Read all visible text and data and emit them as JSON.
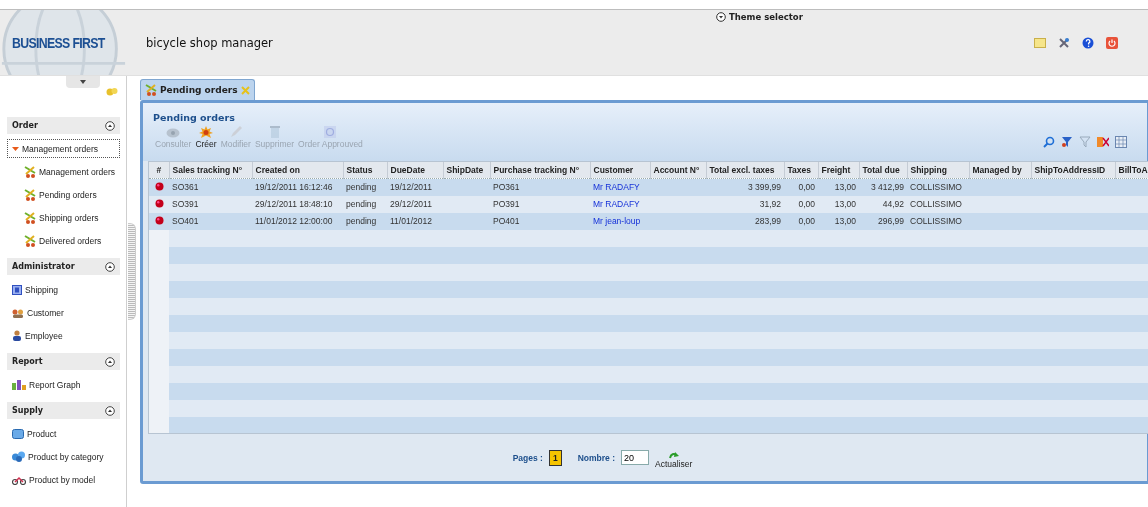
{
  "header": {
    "logo": "BUSINESS FIRST",
    "app_title": "bicycle shop manager",
    "theme_selector": "Theme selector"
  },
  "sidebar": {
    "groups": [
      {
        "title": "Order",
        "expanded": true,
        "items": [
          {
            "label": "Management orders",
            "kind": "folder",
            "expanded": true,
            "selected": true,
            "children": [
              {
                "label": "Management orders",
                "kind": "orders",
                "selected": false
              },
              {
                "label": "Pending orders",
                "kind": "orders",
                "selected": false
              },
              {
                "label": "Shipping orders",
                "kind": "orders",
                "selected": false
              },
              {
                "label": "Delivered orders",
                "kind": "orders",
                "selected": false
              }
            ]
          }
        ]
      },
      {
        "title": "Administrator",
        "expanded": true,
        "items": [
          {
            "label": "Shipping",
            "kind": "shipping",
            "selected": false
          },
          {
            "label": "Customer",
            "kind": "customer",
            "selected": false
          },
          {
            "label": "Employee",
            "kind": "employee",
            "selected": false
          }
        ]
      },
      {
        "title": "Report",
        "expanded": true,
        "items": [
          {
            "label": "Report Graph",
            "kind": "report",
            "selected": false
          }
        ]
      },
      {
        "title": "Supply",
        "expanded": true,
        "items": [
          {
            "label": "Product",
            "kind": "product",
            "selected": false
          },
          {
            "label": "Product by category",
            "kind": "category",
            "selected": false
          },
          {
            "label": "Product by model",
            "kind": "bike",
            "selected": false
          }
        ]
      }
    ]
  },
  "tabs": [
    {
      "label": "Pending orders",
      "selected": true
    }
  ],
  "panel": {
    "title": "Pending orders",
    "toolbar": [
      {
        "label": "Consulter",
        "kind": "view",
        "disabled": true
      },
      {
        "label": "Créer",
        "kind": "create",
        "disabled": false
      },
      {
        "label": "Modifier",
        "kind": "edit",
        "disabled": true
      },
      {
        "label": "Supprimer",
        "kind": "delete",
        "disabled": true
      },
      {
        "label": "Order Approuved",
        "kind": "approve",
        "disabled": true
      }
    ],
    "table": {
      "columns": [
        {
          "label": "#",
          "kind": "status"
        },
        {
          "label": "Sales tracking N°",
          "kind": "text"
        },
        {
          "label": "Created on",
          "kind": "text"
        },
        {
          "label": "Status",
          "kind": "text"
        },
        {
          "label": "DueDate",
          "kind": "text"
        },
        {
          "label": "ShipDate",
          "kind": "text"
        },
        {
          "label": "Purchase tracking N°",
          "kind": "text"
        },
        {
          "label": "Customer",
          "kind": "link"
        },
        {
          "label": "Account N°",
          "kind": "text"
        },
        {
          "label": "Total excl. taxes",
          "kind": "number"
        },
        {
          "label": "Taxes",
          "kind": "number"
        },
        {
          "label": "Freight",
          "kind": "number"
        },
        {
          "label": "Total due",
          "kind": "number"
        },
        {
          "label": "Shipping",
          "kind": "text"
        },
        {
          "label": "Managed by",
          "kind": "text"
        },
        {
          "label": "ShipToAddressID",
          "kind": "text"
        },
        {
          "label": "BillToA",
          "kind": "text"
        }
      ],
      "rows": [
        {
          "selected": false,
          "cells": [
            "",
            "SO361",
            "19/12/2011 16:12:46",
            "pending",
            "19/12/2011",
            "",
            "PO361",
            "Mr RADAFY",
            "",
            "3 399,99",
            "0,00",
            "13,00",
            "3 412,99",
            "COLLISSIMO",
            "",
            "",
            ""
          ]
        },
        {
          "selected": false,
          "cells": [
            "",
            "SO391",
            "29/12/2011 18:48:10",
            "pending",
            "29/12/2011",
            "",
            "PO391",
            "Mr RADAFY",
            "",
            "31,92",
            "0,00",
            "13,00",
            "44,92",
            "COLLISSIMO",
            "",
            "",
            ""
          ]
        },
        {
          "selected": false,
          "cells": [
            "",
            "SO401",
            "11/01/2012 12:00:00",
            "pending",
            "11/01/2012",
            "",
            "PO401",
            "Mr jean-loup",
            "",
            "283,99",
            "0,00",
            "13,00",
            "296,99",
            "COLLISSIMO",
            "",
            "",
            ""
          ]
        }
      ]
    },
    "pager": {
      "pages_label": "Pages :",
      "current_page": "1",
      "count_label": "Nombre :",
      "count_value": "20",
      "refresh": "Actualiser"
    }
  }
}
